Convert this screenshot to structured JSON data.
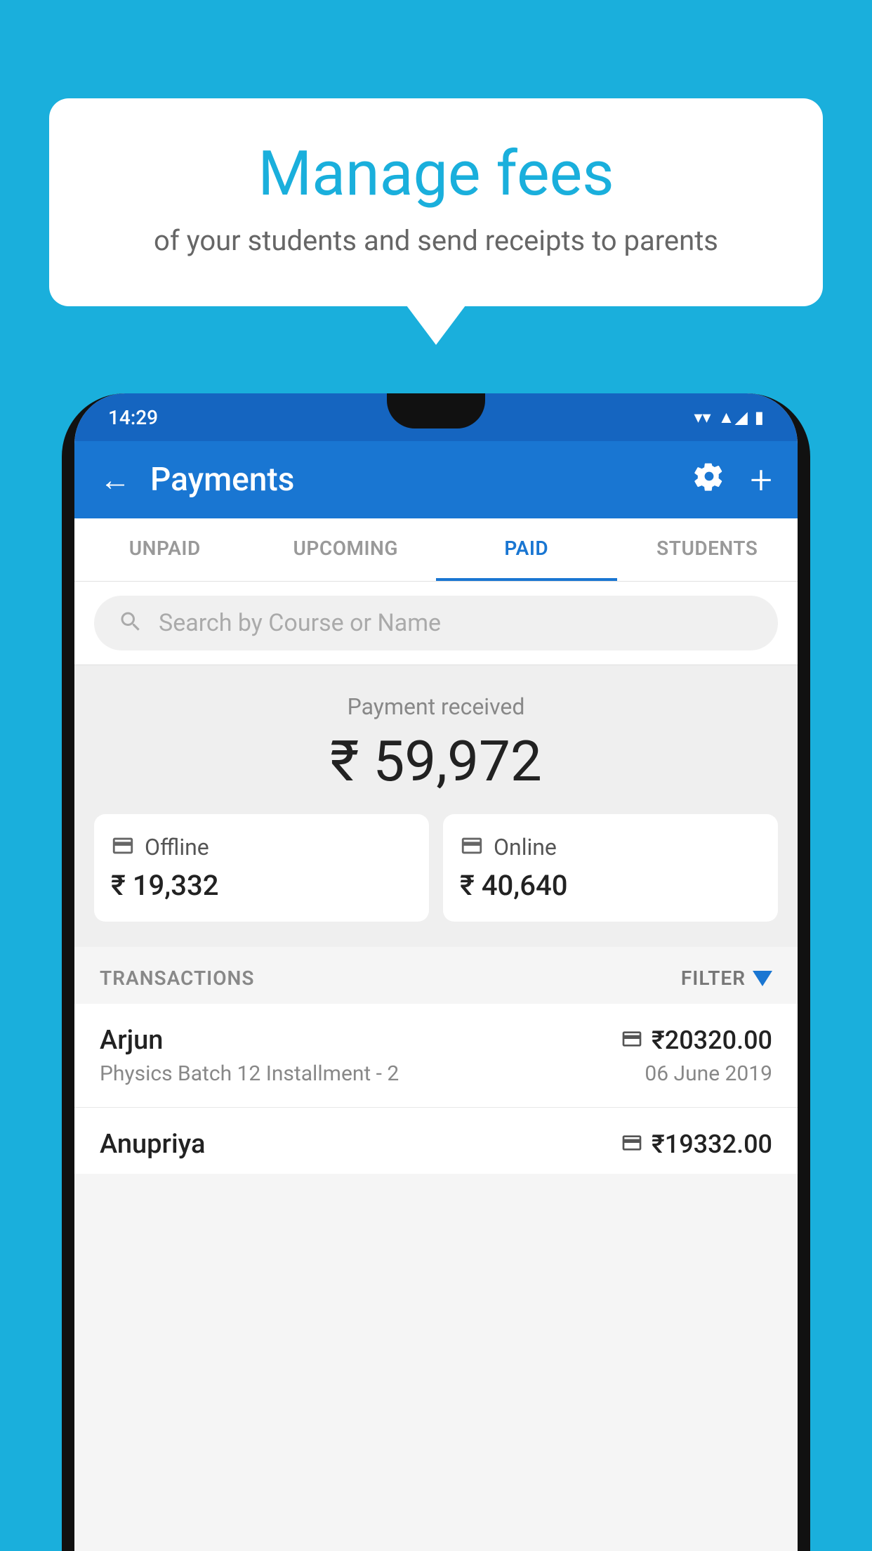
{
  "background_color": "#1AAFDC",
  "speech_bubble": {
    "title": "Manage fees",
    "subtitle": "of your students and send receipts to parents"
  },
  "status_bar": {
    "time": "14:29",
    "wifi": "▼",
    "signal": "▲",
    "battery": "▮"
  },
  "app_bar": {
    "title": "Payments",
    "back_icon": "←",
    "gear_icon": "⚙",
    "plus_icon": "+"
  },
  "tabs": [
    {
      "label": "UNPAID",
      "active": false
    },
    {
      "label": "UPCOMING",
      "active": false
    },
    {
      "label": "PAID",
      "active": true
    },
    {
      "label": "STUDENTS",
      "active": false
    }
  ],
  "search": {
    "placeholder": "Search by Course or Name"
  },
  "payment_received": {
    "label": "Payment received",
    "amount": "₹ 59,972",
    "offline": {
      "label": "Offline",
      "amount": "₹ 19,332"
    },
    "online": {
      "label": "Online",
      "amount": "₹ 40,640"
    }
  },
  "transactions_section": {
    "label": "TRANSACTIONS",
    "filter_label": "FILTER"
  },
  "transactions": [
    {
      "name": "Arjun",
      "course": "Physics Batch 12 Installment - 2",
      "amount": "₹20320.00",
      "date": "06 June 2019",
      "payment_type": "online"
    },
    {
      "name": "Anupriya",
      "course": "",
      "amount": "₹19332.00",
      "date": "",
      "payment_type": "offline"
    }
  ]
}
